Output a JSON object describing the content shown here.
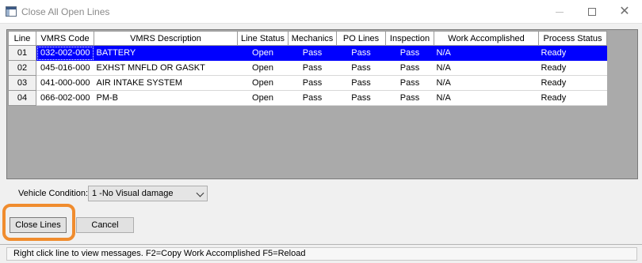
{
  "window": {
    "title": "Close All Open Lines",
    "controls": {
      "minimize_icon": "minimize-icon",
      "maximize_icon": "maximize-icon",
      "close_icon": "close-icon"
    }
  },
  "grid": {
    "columns": [
      "Line",
      "VMRS Code",
      "VMRS Description",
      "Line Status",
      "Mechanics",
      "PO Lines",
      "Inspection",
      "Work Accomplished",
      "Process Status"
    ],
    "rows": [
      {
        "line": "01",
        "vmrs_code": "032-002-000",
        "description": "BATTERY",
        "line_status": "Open",
        "mechanics": "Pass",
        "po_lines": "Pass",
        "inspection": "Pass",
        "work_accomplished": "N/A",
        "process_status": "Ready"
      },
      {
        "line": "02",
        "vmrs_code": "045-016-000",
        "description": "EXHST MNFLD OR GASKT",
        "line_status": "Open",
        "mechanics": "Pass",
        "po_lines": "Pass",
        "inspection": "Pass",
        "work_accomplished": "N/A",
        "process_status": "Ready"
      },
      {
        "line": "03",
        "vmrs_code": "041-000-000",
        "description": "AIR INTAKE SYSTEM",
        "line_status": "Open",
        "mechanics": "Pass",
        "po_lines": "Pass",
        "inspection": "Pass",
        "work_accomplished": "N/A",
        "process_status": "Ready"
      },
      {
        "line": "04",
        "vmrs_code": "066-002-000",
        "description": "PM-B",
        "line_status": "Open",
        "mechanics": "Pass",
        "po_lines": "Pass",
        "inspection": "Pass",
        "work_accomplished": "N/A",
        "process_status": "Ready"
      }
    ],
    "selected_row": "01",
    "selection_color": "#0000ff"
  },
  "vehicle_condition": {
    "label": "Vehicle Condition:",
    "value": "1 -No Visual damage"
  },
  "buttons": {
    "close_lines": "Close Lines",
    "cancel": "Cancel"
  },
  "highlight_color": "#f08c2e",
  "status_bar": {
    "text": "Right click line to view messages.  F2=Copy Work Accomplished  F5=Reload"
  }
}
